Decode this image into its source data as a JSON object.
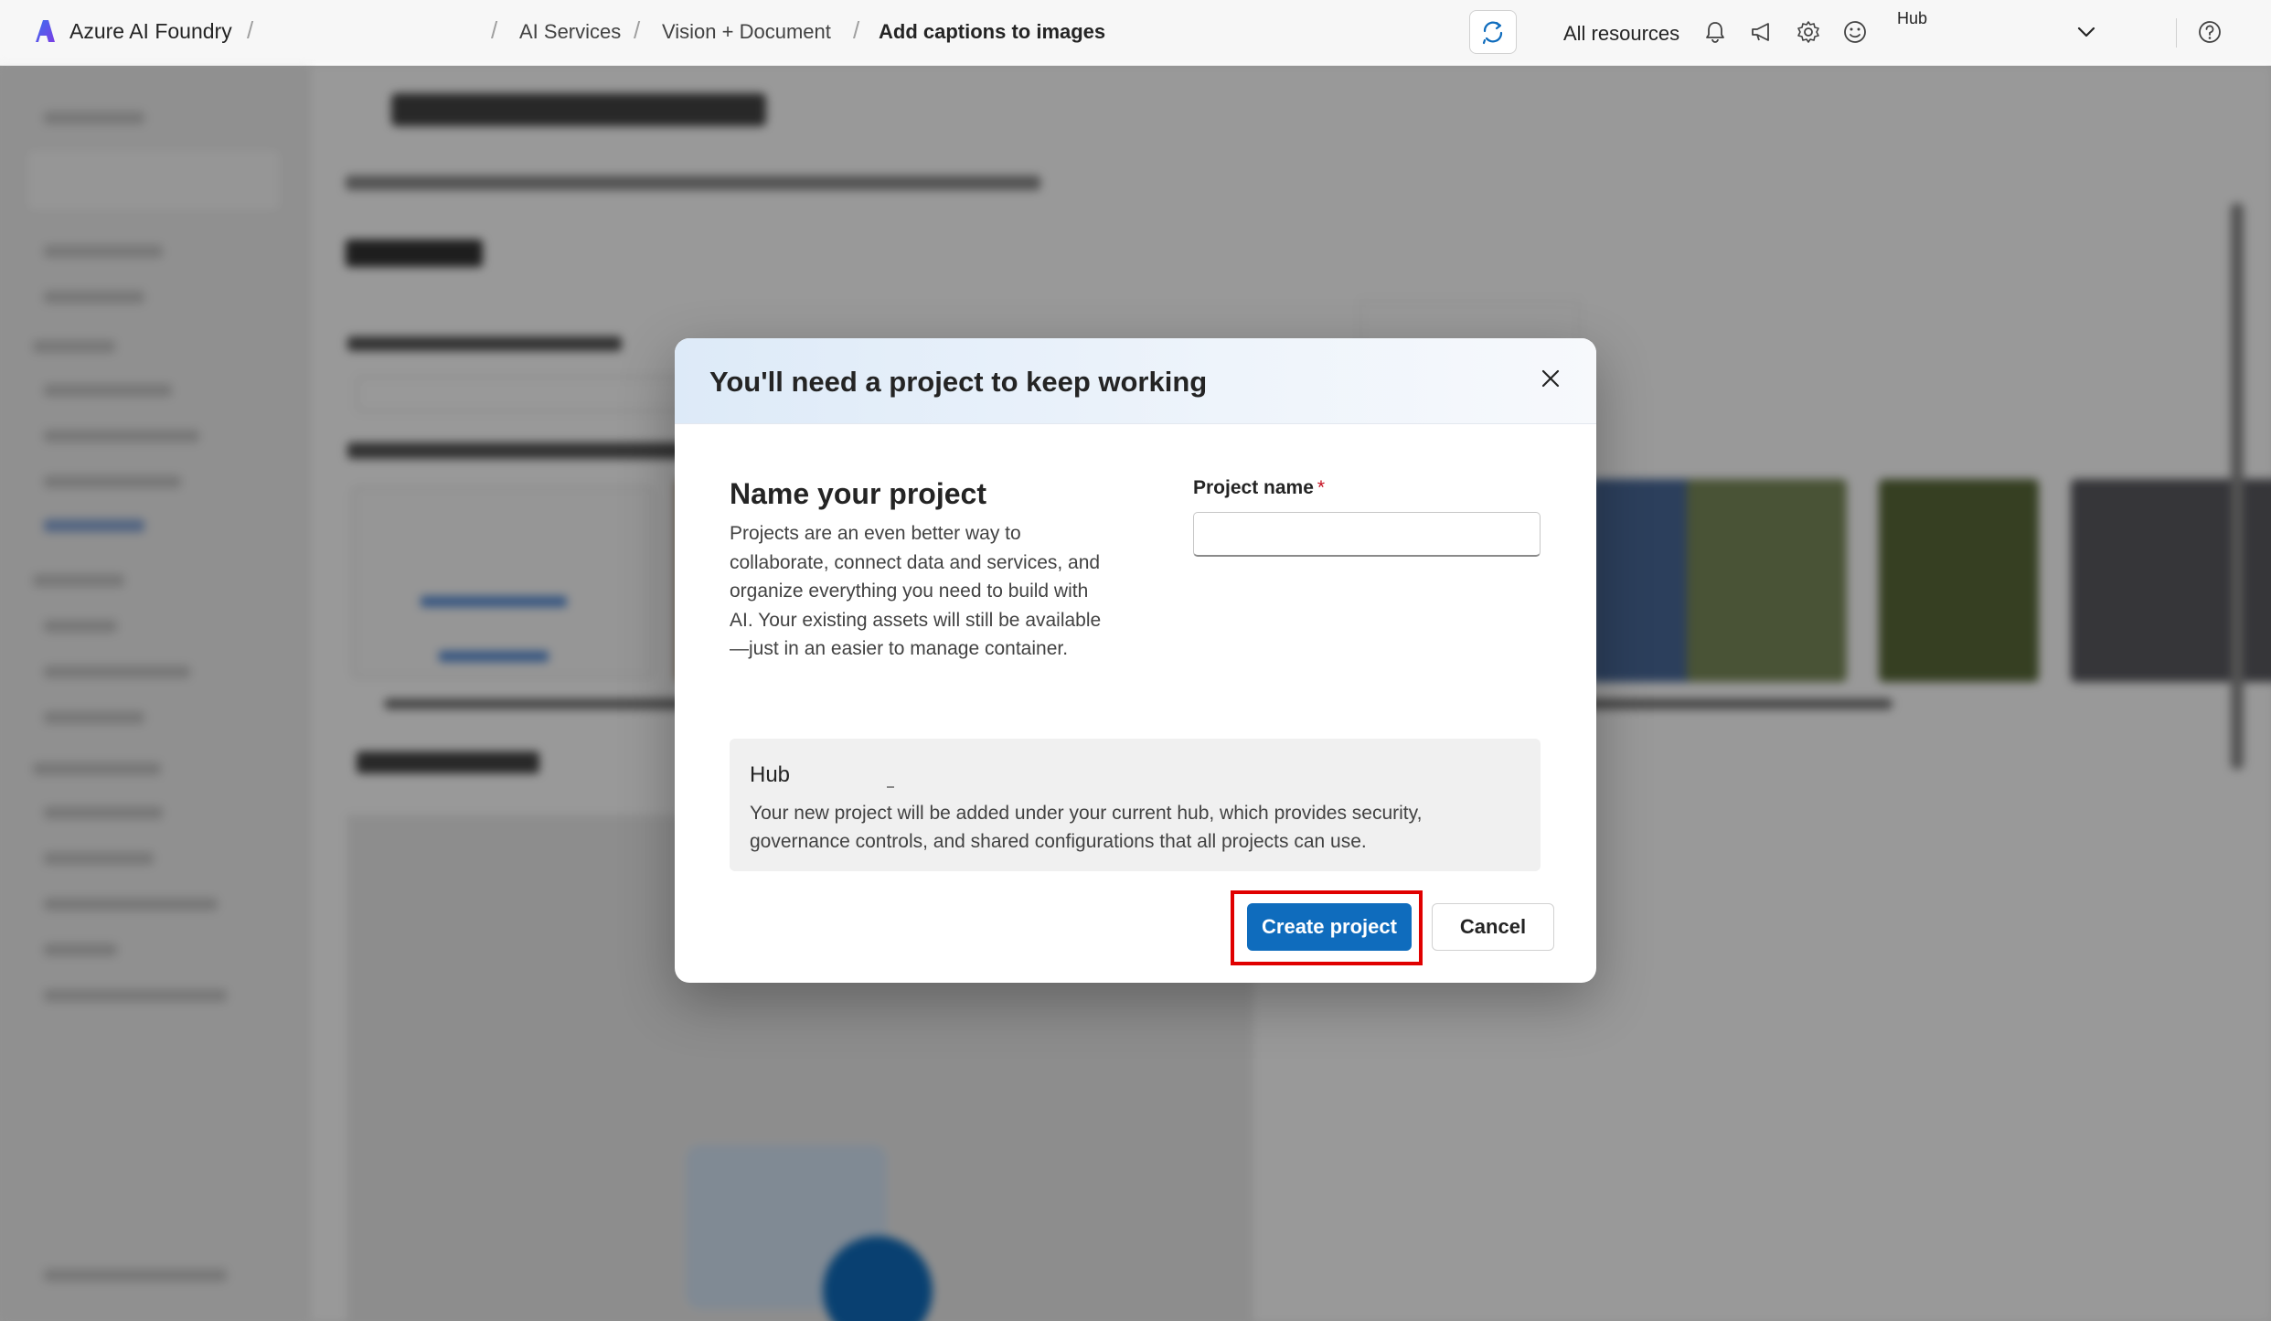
{
  "topbar": {
    "brand": "Azure AI Foundry",
    "breadcrumbs": [
      "AI Services",
      "Vision + Document",
      "Add captions to images"
    ],
    "all_resources": "All resources",
    "hub": "Hub",
    "icons": [
      "copilot-icon",
      "bell-icon",
      "megaphone-icon",
      "gear-icon",
      "smiley-icon",
      "chevron-down-icon",
      "help-icon"
    ]
  },
  "dialog": {
    "title": "You'll need a project to keep working",
    "section_title": "Name your project",
    "section_description": "Projects are an even better way to collaborate, connect data and services, and organize everything you need to build with AI. Your existing assets will still be available—just in an easier to manage container.",
    "field_label": "Project name",
    "required_mark": "*",
    "field_value": "",
    "hub_title": "Hub",
    "hub_description": "Your new project will be added under your current hub, which provides security, governance controls, and shared configurations that all projects can use.",
    "primary_button": "Create project",
    "secondary_button": "Cancel"
  },
  "colors": {
    "accent": "#0f6cbd",
    "highlight": "#e00000",
    "required": "#c50f1f"
  }
}
